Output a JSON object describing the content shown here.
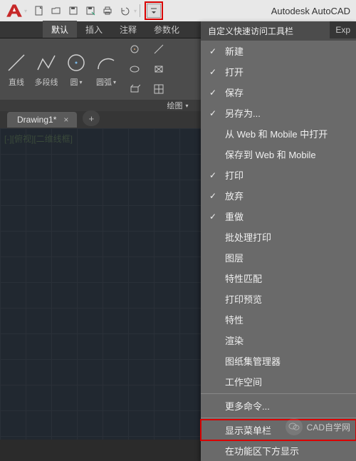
{
  "app_title": "Autodesk AutoCAD",
  "qat": {
    "dropdown_tooltip": "自定义快速访问工具栏"
  },
  "ribbon_tabs": [
    "默认",
    "插入",
    "注释",
    "参数化"
  ],
  "ribbon_tabs_overflow": "Exp",
  "active_tab_index": 0,
  "draw_panel": {
    "title": "绘图",
    "line": "直线",
    "polyline": "多段线",
    "circle": "圆",
    "arc": "圆弧"
  },
  "doc": {
    "name": "Drawing1*"
  },
  "view_label": "[-][俯视][二维线框]",
  "menu": {
    "header": "自定义快速访问工具栏",
    "items": [
      {
        "label": "新建",
        "checked": true
      },
      {
        "label": "打开",
        "checked": true
      },
      {
        "label": "保存",
        "checked": true
      },
      {
        "label": "另存为...",
        "checked": true
      },
      {
        "label": "从 Web 和 Mobile 中打开",
        "checked": false
      },
      {
        "label": "保存到 Web 和 Mobile",
        "checked": false
      },
      {
        "label": "打印",
        "checked": true
      },
      {
        "label": "放弃",
        "checked": true
      },
      {
        "label": "重做",
        "checked": true
      },
      {
        "label": "批处理打印",
        "checked": false
      },
      {
        "label": "图层",
        "checked": false
      },
      {
        "label": "特性匹配",
        "checked": false
      },
      {
        "label": "打印预览",
        "checked": false
      },
      {
        "label": "特性",
        "checked": false
      },
      {
        "label": "渲染",
        "checked": false
      },
      {
        "label": "图纸集管理器",
        "checked": false
      },
      {
        "label": "工作空间",
        "checked": false
      }
    ],
    "more": "更多命令...",
    "show_menubar": "显示菜单栏",
    "below_ribbon": "在功能区下方显示"
  },
  "watermark": "CAD自学网"
}
